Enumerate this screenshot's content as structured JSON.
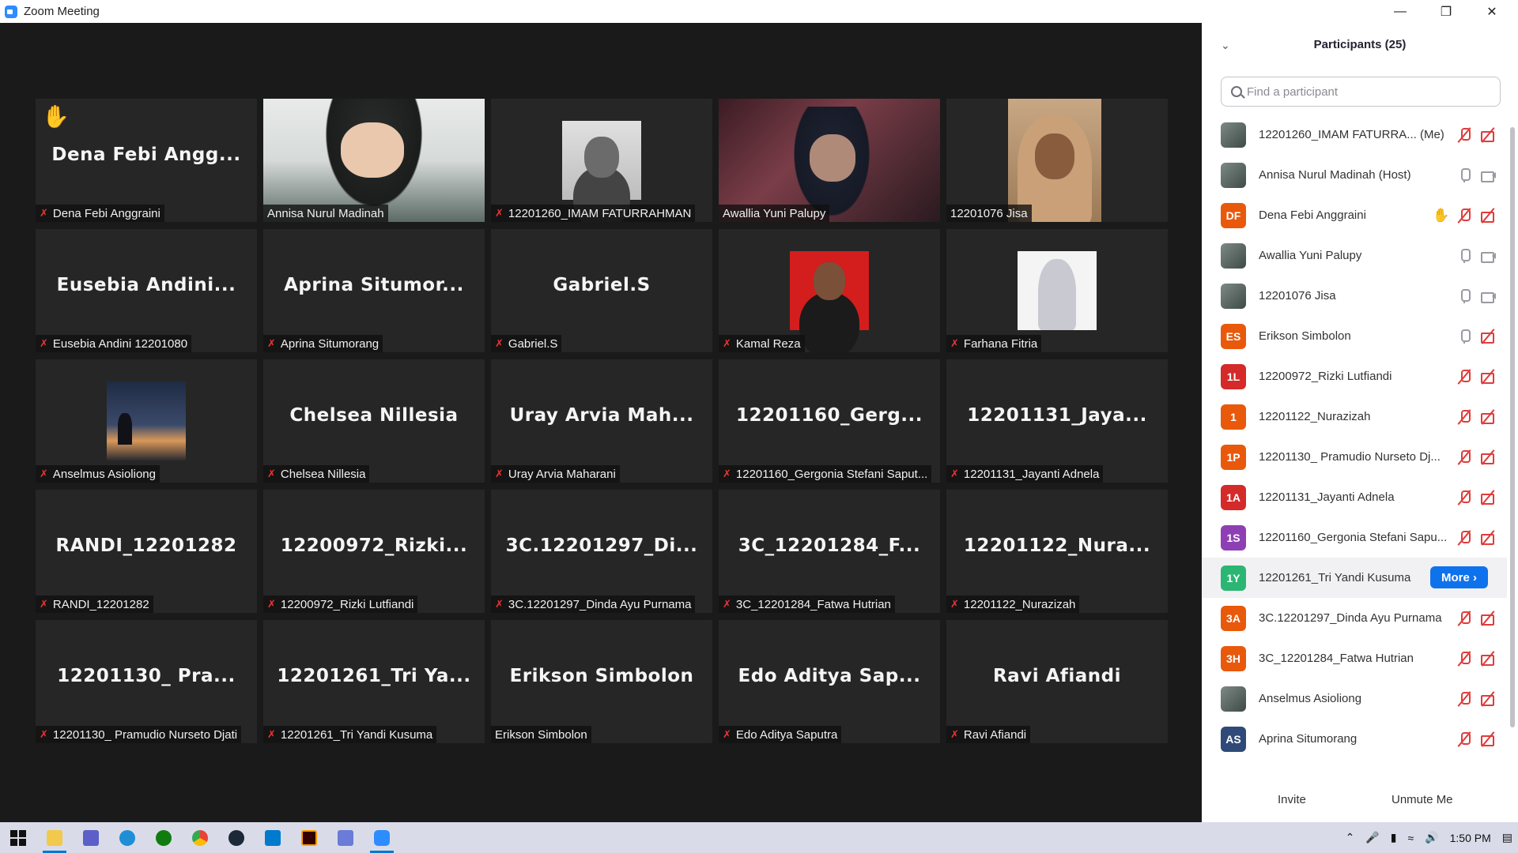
{
  "window": {
    "title": "Zoom Meeting"
  },
  "tiles": [
    {
      "big": "Dena Febi Angg...",
      "label": "Dena Febi Anggraini",
      "muted": true,
      "hand": true,
      "kind": "name"
    },
    {
      "big": "",
      "label": "Annisa Nurul Madinah",
      "muted": false,
      "kind": "photo-annisa"
    },
    {
      "big": "",
      "label": "12201260_IMAM FATURRAHMAN",
      "muted": true,
      "kind": "thumb-imam"
    },
    {
      "big": "",
      "label": "Awallia Yuni Palupy",
      "muted": false,
      "kind": "photo-awallia",
      "active": true
    },
    {
      "big": "",
      "label": "12201076 Jisa",
      "muted": false,
      "kind": "photo-jisa"
    },
    {
      "big": "Eusebia Andini...",
      "label": "Eusebia Andini 12201080",
      "muted": true,
      "kind": "name"
    },
    {
      "big": "Aprina Situmor...",
      "label": "Aprina Situmorang",
      "muted": true,
      "kind": "name"
    },
    {
      "big": "Gabriel.S",
      "label": "Gabriel.S",
      "muted": true,
      "kind": "name"
    },
    {
      "big": "",
      "label": "Kamal Reza",
      "muted": true,
      "kind": "thumb-kamal"
    },
    {
      "big": "",
      "label": "Farhana Fitria",
      "muted": true,
      "kind": "thumb-farhana"
    },
    {
      "big": "",
      "label": "Anselmus Asioliong",
      "muted": true,
      "kind": "thumb-anselmus"
    },
    {
      "big": "Chelsea Nillesia",
      "label": "Chelsea Nillesia",
      "muted": true,
      "kind": "name"
    },
    {
      "big": "Uray Arvia Mah...",
      "label": "Uray Arvia Maharani",
      "muted": true,
      "kind": "name"
    },
    {
      "big": "12201160_Gerg...",
      "label": "12201160_Gergonia Stefani Saput...",
      "muted": true,
      "kind": "name"
    },
    {
      "big": "12201131_Jaya...",
      "label": "12201131_Jayanti Adnela",
      "muted": true,
      "kind": "name"
    },
    {
      "big": "RANDI_12201282",
      "label": "RANDI_12201282",
      "muted": true,
      "kind": "name"
    },
    {
      "big": "12200972_Rizki...",
      "label": "12200972_Rizki Lutfiandi",
      "muted": true,
      "kind": "name"
    },
    {
      "big": "3C.12201297_Di...",
      "label": "3C.12201297_Dinda Ayu Purnama",
      "muted": true,
      "kind": "name"
    },
    {
      "big": "3C_12201284_F...",
      "label": "3C_12201284_Fatwa Hutrian",
      "muted": true,
      "kind": "name"
    },
    {
      "big": "12201122_Nura...",
      "label": "12201122_Nurazizah",
      "muted": true,
      "kind": "name"
    },
    {
      "big": "12201130_ Pra...",
      "label": "12201130_ Pramudio Nurseto Djati",
      "muted": true,
      "kind": "name"
    },
    {
      "big": "12201261_Tri Ya...",
      "label": "12201261_Tri Yandi Kusuma",
      "muted": true,
      "kind": "name"
    },
    {
      "big": "Erikson Simbolon",
      "label": "Erikson Simbolon",
      "muted": false,
      "kind": "name"
    },
    {
      "big": "Edo Aditya Sap...",
      "label": "Edo Aditya Saputra",
      "muted": true,
      "kind": "name"
    },
    {
      "big": "Ravi Afiandi",
      "label": "Ravi Afiandi",
      "muted": true,
      "kind": "name"
    }
  ],
  "panel": {
    "title": "Participants (25)",
    "search_placeholder": "Find a participant",
    "participants": [
      {
        "initials": "",
        "color": "photo",
        "name": "12201260_IMAM FATURRA...  (Me)",
        "mic": "muted",
        "cam": "off"
      },
      {
        "initials": "",
        "color": "photo",
        "name": "Annisa Nurul Madinah (Host)",
        "mic": "on",
        "cam": "on"
      },
      {
        "initials": "DF",
        "color": "#e8590c",
        "name": "Dena Febi Anggraini",
        "mic": "muted",
        "cam": "off",
        "hand": true
      },
      {
        "initials": "",
        "color": "photo",
        "name": "Awallia Yuni Palupy",
        "mic": "on",
        "cam": "on"
      },
      {
        "initials": "",
        "color": "photo",
        "name": "12201076 Jisa",
        "mic": "on",
        "cam": "on"
      },
      {
        "initials": "ES",
        "color": "#e8590c",
        "name": "Erikson Simbolon",
        "mic": "on",
        "cam": "off"
      },
      {
        "initials": "1L",
        "color": "#d42a2a",
        "name": "12200972_Rizki Lutfiandi",
        "mic": "muted",
        "cam": "off"
      },
      {
        "initials": "1",
        "color": "#e8590c",
        "name": "12201122_Nurazizah",
        "mic": "muted",
        "cam": "off"
      },
      {
        "initials": "1P",
        "color": "#e8590c",
        "name": "12201130_ Pramudio Nurseto Dj...",
        "mic": "muted",
        "cam": "off"
      },
      {
        "initials": "1A",
        "color": "#d42a2a",
        "name": "12201131_Jayanti Adnela",
        "mic": "muted",
        "cam": "off"
      },
      {
        "initials": "1S",
        "color": "#8e3fb4",
        "name": "12201160_Gergonia Stefani Sapu...",
        "mic": "muted",
        "cam": "off"
      },
      {
        "initials": "1Y",
        "color": "#2bb673",
        "name": "12201261_Tri Yandi Kusuma",
        "more": "More",
        "hover": true
      },
      {
        "initials": "3A",
        "color": "#e8590c",
        "name": "3C.12201297_Dinda Ayu Purnama",
        "mic": "muted",
        "cam": "off"
      },
      {
        "initials": "3H",
        "color": "#e8590c",
        "name": "3C_12201284_Fatwa Hutrian",
        "mic": "muted",
        "cam": "off"
      },
      {
        "initials": "",
        "color": "photo",
        "name": "Anselmus Asioliong",
        "mic": "muted",
        "cam": "off"
      },
      {
        "initials": "AS",
        "color": "#2f4a78",
        "name": "Aprina Situmorang",
        "mic": "muted",
        "cam": "off"
      }
    ],
    "invite_label": "Invite",
    "unmute_label": "Unmute Me"
  },
  "taskbar": {
    "time": "1:50 PM"
  }
}
